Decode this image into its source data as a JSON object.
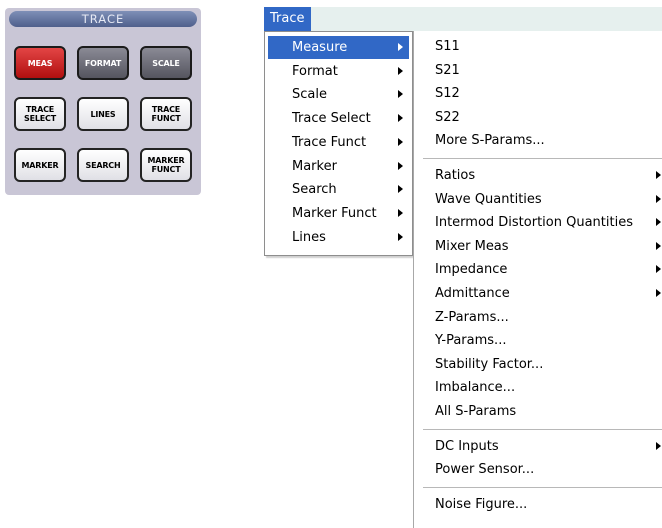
{
  "panel": {
    "title": "TRACE",
    "keys": [
      {
        "id": "meas",
        "label": "MEAS",
        "style": "red"
      },
      {
        "id": "format",
        "label": "FORMAT",
        "style": "dark"
      },
      {
        "id": "scale",
        "label": "SCALE",
        "style": "dark"
      },
      {
        "id": "trace-select",
        "label": "TRACE SELECT",
        "style": "light"
      },
      {
        "id": "lines",
        "label": "LINES",
        "style": "light"
      },
      {
        "id": "trace-funct",
        "label": "TRACE FUNCT",
        "style": "light"
      },
      {
        "id": "marker",
        "label": "MARKER",
        "style": "light"
      },
      {
        "id": "search",
        "label": "SEARCH",
        "style": "light"
      },
      {
        "id": "marker-funct",
        "label": "MARKER FUNCT",
        "style": "light"
      }
    ]
  },
  "menubar": {
    "active_label": "Trace"
  },
  "menu": {
    "items": [
      {
        "label": "Measure",
        "submenu": true,
        "selected": true
      },
      {
        "label": "Format",
        "submenu": true
      },
      {
        "label": "Scale",
        "submenu": true
      },
      {
        "label": "Trace Select",
        "submenu": true
      },
      {
        "label": "Trace Funct",
        "submenu": true
      },
      {
        "label": "Marker",
        "submenu": true
      },
      {
        "label": "Search",
        "submenu": true
      },
      {
        "label": "Marker Funct",
        "submenu": true
      },
      {
        "label": "Lines",
        "submenu": true
      }
    ]
  },
  "submenu": {
    "groups": [
      [
        {
          "label": "S11"
        },
        {
          "label": "S21"
        },
        {
          "label": "S12"
        },
        {
          "label": "S22"
        },
        {
          "label": "More S-Params..."
        }
      ],
      [
        {
          "label": "Ratios",
          "submenu": true
        },
        {
          "label": "Wave Quantities",
          "submenu": true
        },
        {
          "label": "Intermod Distortion Quantities",
          "submenu": true
        },
        {
          "label": "Mixer Meas",
          "submenu": true
        },
        {
          "label": "Impedance",
          "submenu": true
        },
        {
          "label": "Admittance",
          "submenu": true
        },
        {
          "label": "Z-Params..."
        },
        {
          "label": "Y-Params..."
        },
        {
          "label": "Stability Factor..."
        },
        {
          "label": "Imbalance..."
        },
        {
          "label": "All S-Params"
        }
      ],
      [
        {
          "label": "DC Inputs",
          "submenu": true
        },
        {
          "label": "Power Sensor..."
        }
      ],
      [
        {
          "label": "Noise Figure..."
        }
      ]
    ]
  },
  "colors": {
    "highlight": "#3168c6",
    "meas_key": "#c81e1e",
    "panel_bg": "#c9c6d6"
  }
}
